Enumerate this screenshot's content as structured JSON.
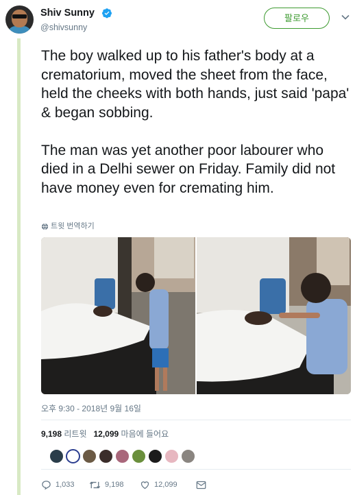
{
  "user": {
    "name": "Shiv Sunny",
    "handle": "@shivsunny",
    "verified": true
  },
  "follow_button": {
    "label": "팔로우"
  },
  "tweet": {
    "text": "The boy walked up to his father's body at a crematorium, moved the sheet from the face, held the cheeks with both hands, just said 'papa' & began sobbing.\n\nThe man was yet another poor labourer who died in a Delhi sewer on Friday. Family did not have money even for cremating him.",
    "translate_label": "트윗 번역하기",
    "timestamp": "오후 9:30 - 2018년 9월 16일"
  },
  "stats": {
    "retweets_count": "9,198",
    "retweets_label": "리트윗",
    "likes_count": "12,099",
    "likes_label": "마음에 들어요"
  },
  "actions": {
    "reply_count": "1,033",
    "retweet_count": "9,198",
    "like_count": "12,099"
  },
  "colors": {
    "accent": "#3c9a2f",
    "secondary_text": "#657786",
    "verified_blue": "#1da1f2",
    "thread_rule": "#d8e9c4"
  },
  "icons": [
    "verified-badge-icon",
    "chevron-down-icon",
    "globe-icon",
    "reply-icon",
    "retweet-icon",
    "heart-icon",
    "message-icon"
  ],
  "liker_avatar_colors": [
    "#2a3d4a",
    "#ffffff",
    "#6b5a44",
    "#3b2d2a",
    "#a9677b",
    "#6a8f3c",
    "#1b1b1b",
    "#e7b7c0",
    "#8a8580"
  ]
}
